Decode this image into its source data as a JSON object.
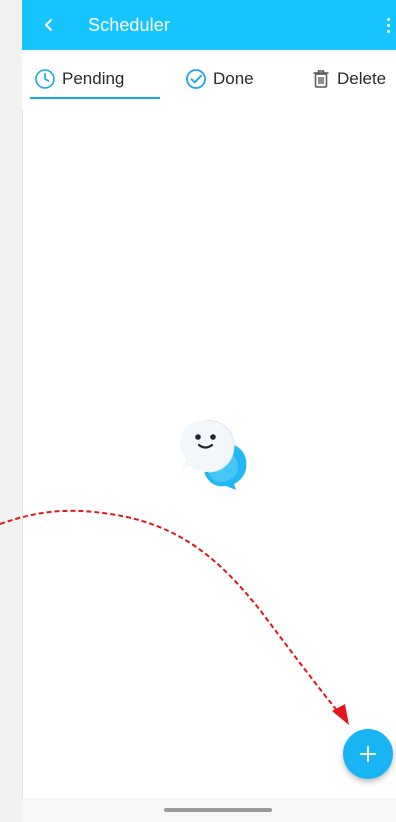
{
  "appbar": {
    "title": "Scheduler",
    "back_icon": "chevron-left-icon",
    "menu_icon": "more-vert-icon"
  },
  "tabs": [
    {
      "label": "Pending",
      "icon": "clock-icon",
      "selected": true
    },
    {
      "label": "Done",
      "icon": "check-circle-icon",
      "selected": false
    },
    {
      "label": "Delete",
      "icon": "trash-icon",
      "selected": false
    }
  ],
  "empty_state": {
    "icon": "chat-bubbles-mascot-icon"
  },
  "fab": {
    "icon": "plus-icon"
  },
  "colors": {
    "accent": "#16c5ff",
    "indicator": "#16a7e6",
    "fab": "#19b4f3",
    "annotation_arrow": "#e3161b"
  }
}
